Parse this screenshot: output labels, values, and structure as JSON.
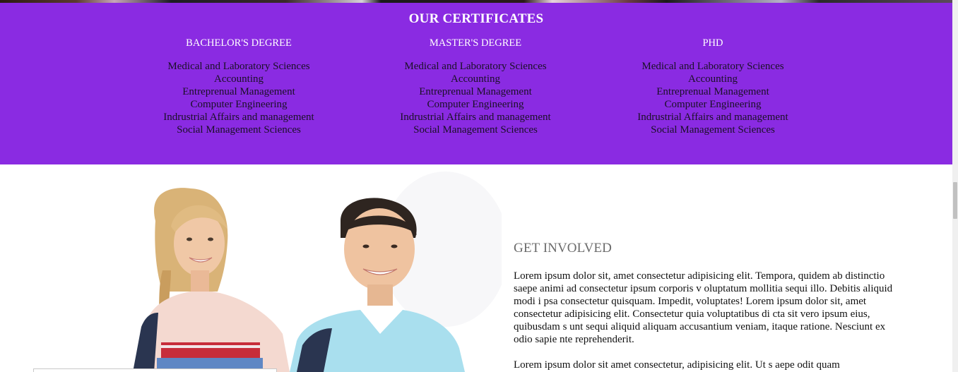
{
  "certificates": {
    "title": "OUR CERTIFICATES",
    "accent_color": "#8a2be2",
    "columns": [
      {
        "heading": "BACHELOR'S DEGREE",
        "items": [
          "Medical and Laboratory Sciences",
          "Accounting",
          "Entreprenual Management",
          "Computer Engineering",
          "Indrustrial Affairs and management",
          "Social Management Sciences"
        ]
      },
      {
        "heading": "MASTER'S DEGREE",
        "items": [
          "Medical and Laboratory Sciences",
          "Accounting",
          "Entreprenual Management",
          "Computer Engineering",
          "Indrustrial Affairs and management",
          "Social Management Sciences"
        ]
      },
      {
        "heading": "PHD",
        "items": [
          "Medical and Laboratory Sciences",
          "Accounting",
          "Entreprenual Management",
          "Computer Engineering",
          "Indrustrial Affairs and management",
          "Social Management Sciences"
        ]
      }
    ]
  },
  "involved": {
    "heading": "GET INVOLVED",
    "paragraphs": [
      "Lorem ipsum dolor sit, amet consectetur adipisicing elit. Tempora, quidem ab distinctio saepe animi ad consectetur ipsum corporis v oluptatum mollitia sequi illo. Debitis aliquid modi i psa consectetur quisquam. Impedit, voluptates! Lorem ipsum dolor sit, amet consectetur adipisicing elit. Consectetur quia voluptatibus di cta sit vero ipsum eius, quibusdam s unt sequi aliquid aliquam accusantium veniam, itaque ratione. Nesciunt ex odio sapie nte reprehenderit.",
      "Lorem ipsum dolor sit amet consectetur, adipisicing elit. Ut s aepe odit quam"
    ]
  }
}
